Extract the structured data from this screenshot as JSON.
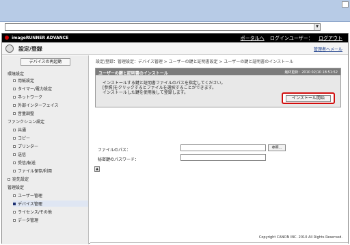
{
  "app": {
    "brand": "imageRUNNER ADVANCE",
    "portal_link": "ポータルへ",
    "login_user_label": "ログインユーザー：",
    "logout_link": "ログアウト",
    "page_title": "設定/登録",
    "mail_to_admin": "管理者へメール"
  },
  "sidebar": {
    "restart_button": "デバイスの再起動",
    "sections": [
      {
        "title": "環境設定",
        "items": [
          "用紙設定",
          "タイマー/電力設定",
          "ネットワーク",
          "外部インターフェイス",
          "音量調整"
        ]
      },
      {
        "title": "ファンクション設定",
        "items": [
          "共通",
          "コピー",
          "プリンター",
          "送信",
          "受信/転送",
          "ファイル保存/利用"
        ]
      },
      {
        "title": "宛先設定",
        "items": []
      },
      {
        "title": "管理設定",
        "items": [
          "ユーザー管理",
          "デバイス管理",
          "ライセンス/その他",
          "データ管理"
        ]
      }
    ],
    "active_item": "デバイス管理"
  },
  "content": {
    "breadcrumb": "設定/登録：管理設定：デバイス管理 > ユーザーの鍵と証明書設定 > ユーザーの鍵と証明書のインストール",
    "panel": {
      "title": "ユーザーの鍵と証明書のインストール",
      "last_updated": "最終更新：2010 02/10 18:51:52",
      "description": [
        "インストールする鍵と証明書ファイルのパスを指定してください。",
        "[参照]をクリックするとファイルを選択することができます。",
        "インストールした鍵を使用後して登録します。"
      ],
      "install_button": "インストール開始"
    },
    "form": {
      "file_path_label": "ファイルのパス：",
      "file_path_value": "",
      "browse_button": "参照...",
      "password_label": "秘密鍵のパスワード：",
      "password_value": ""
    },
    "up_button": "▲",
    "copyright": "Copyright CANON INC. 2010 All Rights Reserved."
  },
  "browser": {
    "url_value": "",
    "dropdown_icon": "▼"
  }
}
